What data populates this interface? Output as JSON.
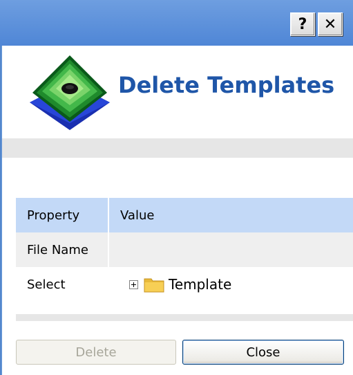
{
  "titlebar": {
    "help_label": "?",
    "close_label": "✕"
  },
  "header": {
    "title": "Delete Templates"
  },
  "properties": {
    "columns": [
      "Property",
      "Value"
    ],
    "rows": [
      {
        "property": "File Name",
        "value": ""
      },
      {
        "property": "Select",
        "value": "Template"
      }
    ]
  },
  "buttons": {
    "delete_label": "Delete",
    "close_label": "Close"
  },
  "colors": {
    "titlebar": "#4f86d6",
    "title_text": "#1f56a8",
    "table_header": "#c3d9f7"
  }
}
